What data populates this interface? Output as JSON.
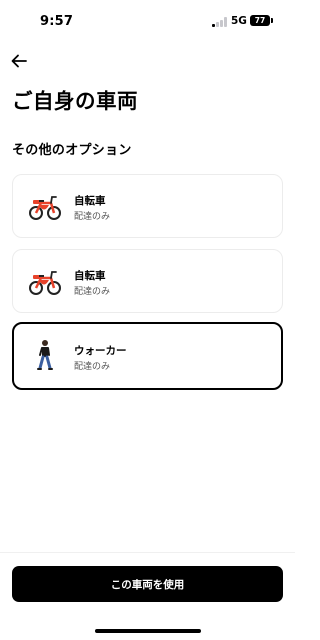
{
  "status_bar": {
    "time": "9:57",
    "network": "5G",
    "battery": "77",
    "signal_bars_active": 1
  },
  "header": {
    "back_icon": "arrow-left-icon",
    "title": "ご自身の車両"
  },
  "options": {
    "section_title": "その他のオプション",
    "items": [
      {
        "name": "自転車",
        "subtitle": "配達のみ",
        "icon": "bicycle-icon",
        "selected": false
      },
      {
        "name": "自転車",
        "subtitle": "配達のみ",
        "icon": "bicycle-icon",
        "selected": false
      },
      {
        "name": "ウォーカー",
        "subtitle": "配達のみ",
        "icon": "walker-icon",
        "selected": true
      }
    ]
  },
  "footer": {
    "primary_label": "この車両を使用"
  },
  "colors": {
    "bike_frame": "#e8432b",
    "button_bg": "#000000",
    "card_border": "#ececec"
  }
}
